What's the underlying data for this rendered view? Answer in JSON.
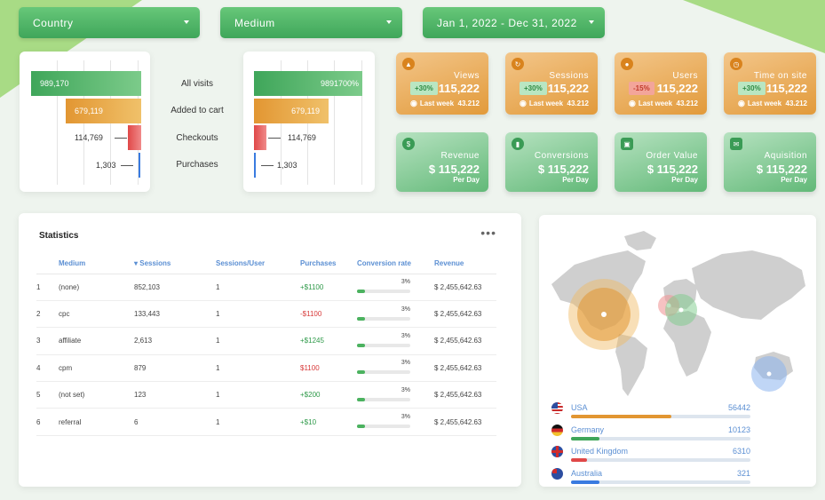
{
  "filters": [
    {
      "label": "Country"
    },
    {
      "label": "Medium"
    },
    {
      "label": "Jan 1, 2022 - Dec 31, 2022"
    }
  ],
  "funnel": {
    "stages": [
      "All visits",
      "Added to cart",
      "Checkouts",
      "Purchases"
    ],
    "left_values": [
      "989,170",
      "679,119",
      "114,769",
      "1,303"
    ],
    "right_values": [
      "9891700%",
      "679,119",
      "114,769",
      "1,303"
    ]
  },
  "kpis": [
    {
      "title": "Views",
      "badge": "+30%",
      "value": "115,222",
      "last_week_label": "Last week",
      "last_week_value": "43.212"
    },
    {
      "title": "Sessions",
      "badge": "+30%",
      "value": "115,222",
      "last_week_label": "Last week",
      "last_week_value": "43.212"
    },
    {
      "title": "Users",
      "badge": "-15%",
      "value": "115,222",
      "last_week_label": "Last week",
      "last_week_value": "43.212"
    },
    {
      "title": "Time on site",
      "badge": "+30%",
      "value": "115,222",
      "last_week_label": "Last week",
      "last_week_value": "43.212"
    },
    {
      "title": "Revenue",
      "value": "$ 115,222",
      "sub": "Per Day"
    },
    {
      "title": "Conversions",
      "value": "$ 115,222",
      "sub": "Per Day"
    },
    {
      "title": "Order Value",
      "value": "$ 115,222",
      "sub": "Per Day"
    },
    {
      "title": "Aquisition",
      "value": "$ 115,222",
      "sub": "Per Day"
    }
  ],
  "statistics": {
    "title": "Statistics",
    "menu": "•••",
    "columns": [
      "",
      "Medium",
      "Sessions",
      "Sessions/User",
      "Purchases",
      "Conversion rate",
      "Revenue"
    ],
    "rows": [
      {
        "n": "1",
        "medium": "(none)",
        "sessions": "852,103",
        "spu": "1",
        "purchases": "+$1100",
        "trend": "pos",
        "conv": "3%",
        "conv_value": 0.15,
        "revenue": "$ 2,455,642.63"
      },
      {
        "n": "2",
        "medium": "cpc",
        "sessions": "133,443",
        "spu": "1",
        "purchases": "-$1100",
        "trend": "neg",
        "conv": "3%",
        "conv_value": 0.15,
        "revenue": "$ 2,455,642.63"
      },
      {
        "n": "3",
        "medium": "affiliate",
        "sessions": "2,613",
        "spu": "1",
        "purchases": "+$1245",
        "trend": "pos",
        "conv": "3%",
        "conv_value": 0.15,
        "revenue": "$ 2,455,642.63"
      },
      {
        "n": "4",
        "medium": "cpm",
        "sessions": "879",
        "spu": "1",
        "purchases": "$1100",
        "trend": "neg",
        "conv": "3%",
        "conv_value": 0.15,
        "revenue": "$ 2,455,642.63"
      },
      {
        "n": "5",
        "medium": "(not set)",
        "sessions": "123",
        "spu": "1",
        "purchases": "+$200",
        "trend": "pos",
        "conv": "3%",
        "conv_value": 0.15,
        "revenue": "$ 2,455,642.63"
      },
      {
        "n": "6",
        "medium": "referral",
        "sessions": "6",
        "spu": "1",
        "purchases": "+$10",
        "trend": "pos",
        "conv": "3%",
        "conv_value": 0.15,
        "revenue": "$ 2,455,642.63"
      }
    ]
  },
  "countries": [
    {
      "name": "USA",
      "value": "56442",
      "share": 0.56,
      "color": "#e29632"
    },
    {
      "name": "Germany",
      "value": "10123",
      "share": 0.16,
      "color": "#3fa65a"
    },
    {
      "name": "United Kingdom",
      "value": "6310",
      "share": 0.09,
      "color": "#e04848"
    },
    {
      "name": "Australia",
      "value": "321",
      "share": 0.16,
      "color": "#3a7be0"
    }
  ]
}
